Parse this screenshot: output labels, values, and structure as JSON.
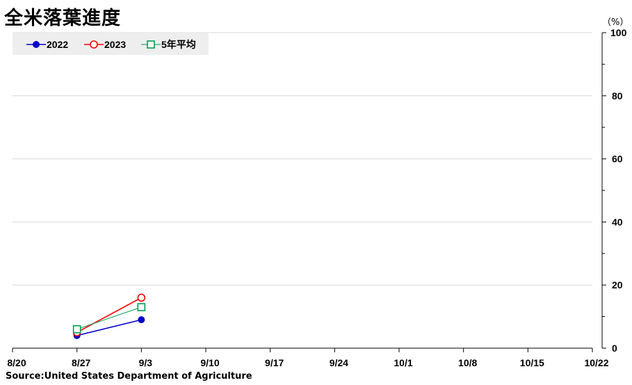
{
  "title": "全米落葉進度",
  "unit_label": "（%）",
  "source": "Source:United States Department of Agriculture",
  "chart_data": {
    "type": "line",
    "title": "全米落葉進度",
    "xlabel": "",
    "ylabel": "（%）",
    "x": [
      "8/20",
      "8/27",
      "9/3",
      "9/10",
      "9/17",
      "9/24",
      "10/1",
      "10/8",
      "10/15",
      "10/22"
    ],
    "ylim": [
      0,
      100
    ],
    "yticks": [
      0,
      20,
      40,
      60,
      80,
      100
    ],
    "grid": true,
    "legend": "top-left",
    "y_axis_side": "right",
    "series": [
      {
        "name": "2022",
        "color": "#0000cc",
        "marker": "filled-circle",
        "values": [
          null,
          4,
          9,
          null,
          null,
          null,
          null,
          null,
          null,
          null
        ]
      },
      {
        "name": "2023",
        "color": "#ff0000",
        "marker": "open-circle",
        "values": [
          null,
          5,
          16,
          null,
          null,
          null,
          null,
          null,
          null,
          null
        ]
      },
      {
        "name": "5年平均",
        "color": "#00a050",
        "marker": "open-square",
        "values": [
          null,
          6,
          13,
          null,
          null,
          null,
          null,
          null,
          null,
          null
        ]
      }
    ]
  }
}
